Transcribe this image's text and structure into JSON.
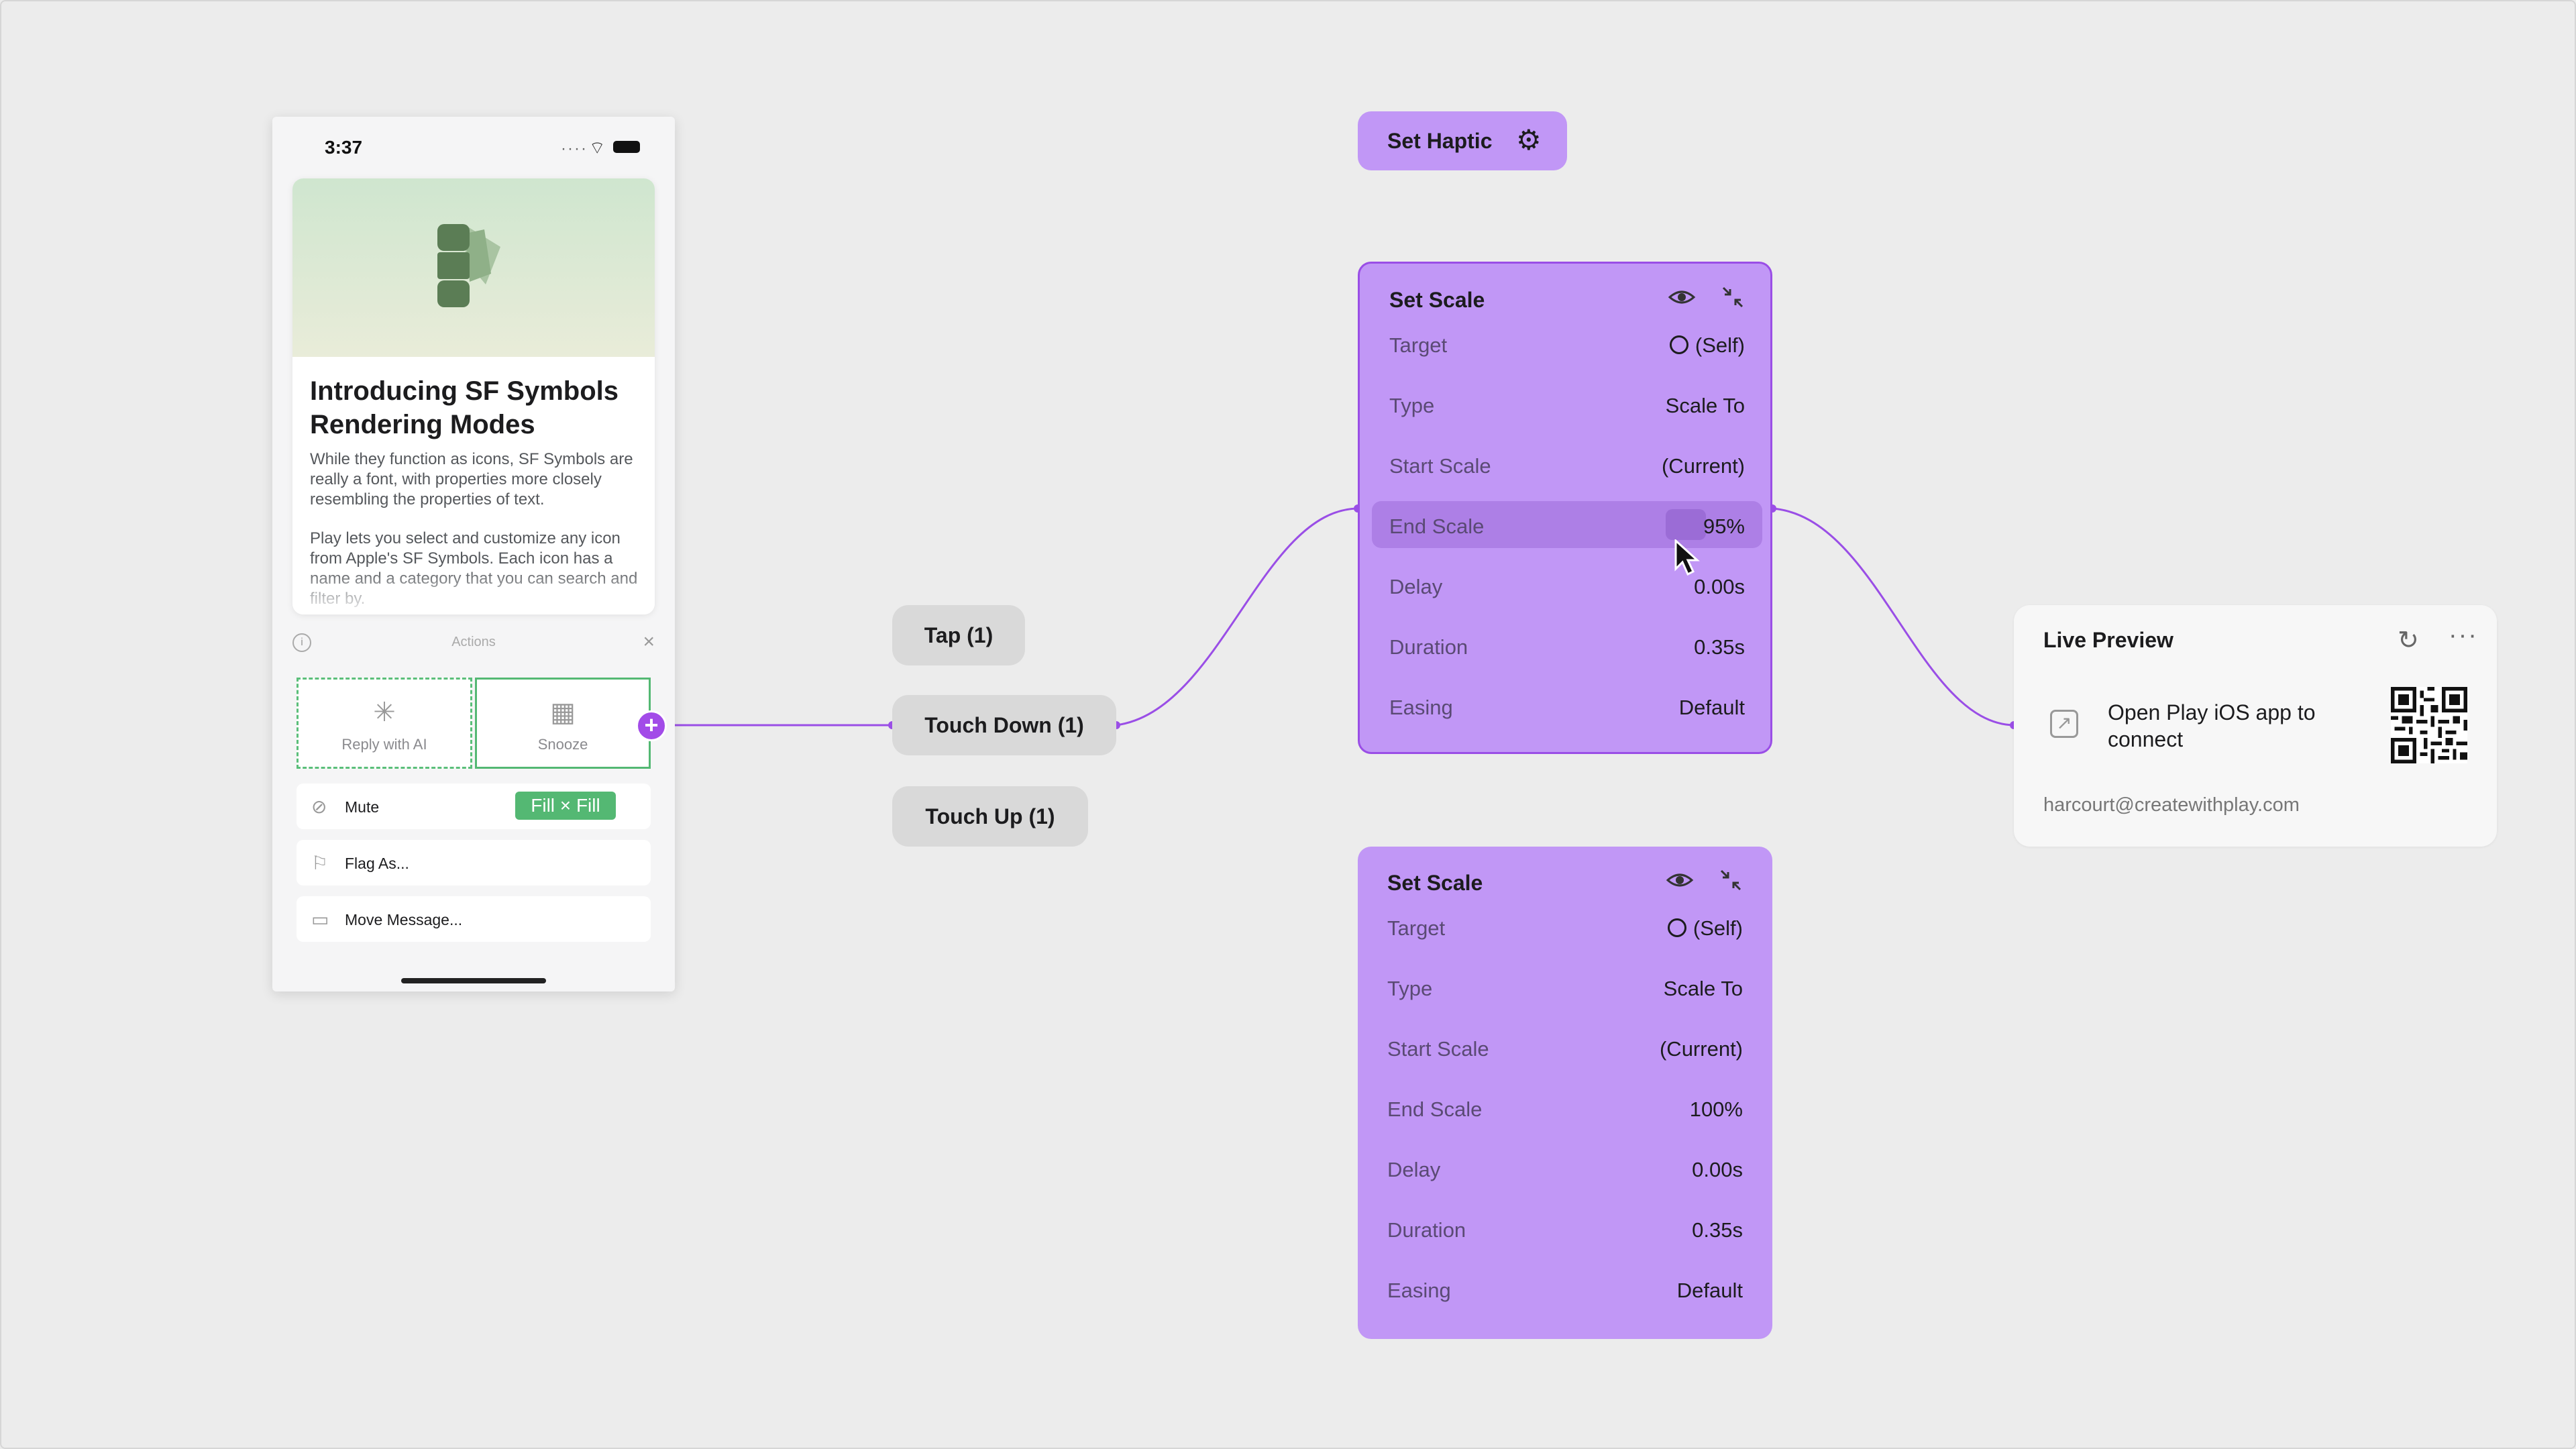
{
  "phone": {
    "time": "3:37",
    "card": {
      "title": "Introducing SF Symbols Rendering Modes",
      "para1": "While they function as icons, SF Symbols are really a font, with properties more closely resembling the properties of text.",
      "para2": "Play lets you select and customize any icon from Apple's SF Symbols. Each icon has a name and a category that you can search and filter by."
    },
    "actions_label": "Actions",
    "tiles": [
      {
        "label": "Reply with AI",
        "icon": "sparkle-icon"
      },
      {
        "label": "Snooze",
        "icon": "calendar-clock-icon"
      }
    ],
    "rows": [
      {
        "label": "Mute",
        "icon": "bell-slash-icon"
      },
      {
        "label": "Flag As...",
        "icon": "flag-icon"
      },
      {
        "label": "Move Message...",
        "icon": "folder-icon"
      }
    ],
    "badge": "Fill × Fill"
  },
  "triggers": [
    "Tap (1)",
    "Touch Down (1)",
    "Touch Up (1)"
  ],
  "haptic": {
    "label": "Set Haptic",
    "icon": "gear-icon"
  },
  "panels": [
    {
      "title": "Set Scale",
      "rows": [
        {
          "key": "Target",
          "value": "(Self)"
        },
        {
          "key": "Type",
          "value": "Scale To"
        },
        {
          "key": "Start Scale",
          "value": "(Current)"
        },
        {
          "key": "End Scale",
          "value": "95%"
        },
        {
          "key": "Delay",
          "value": "0.00s"
        },
        {
          "key": "Duration",
          "value": "0.35s"
        },
        {
          "key": "Easing",
          "value": "Default"
        }
      ]
    },
    {
      "title": "Set Scale",
      "rows": [
        {
          "key": "Target",
          "value": "(Self)"
        },
        {
          "key": "Type",
          "value": "Scale To"
        },
        {
          "key": "Start Scale",
          "value": "(Current)"
        },
        {
          "key": "End Scale",
          "value": "100%"
        },
        {
          "key": "Delay",
          "value": "0.00s"
        },
        {
          "key": "Duration",
          "value": "0.35s"
        },
        {
          "key": "Easing",
          "value": "Default"
        }
      ]
    }
  ],
  "live": {
    "title": "Live Preview",
    "open_text": "Open Play iOS app to connect",
    "email": "harcourt@createwithplay.com"
  },
  "colors": {
    "accent": "#a24be8",
    "panel": "#c197f6",
    "green": "#54b873"
  }
}
